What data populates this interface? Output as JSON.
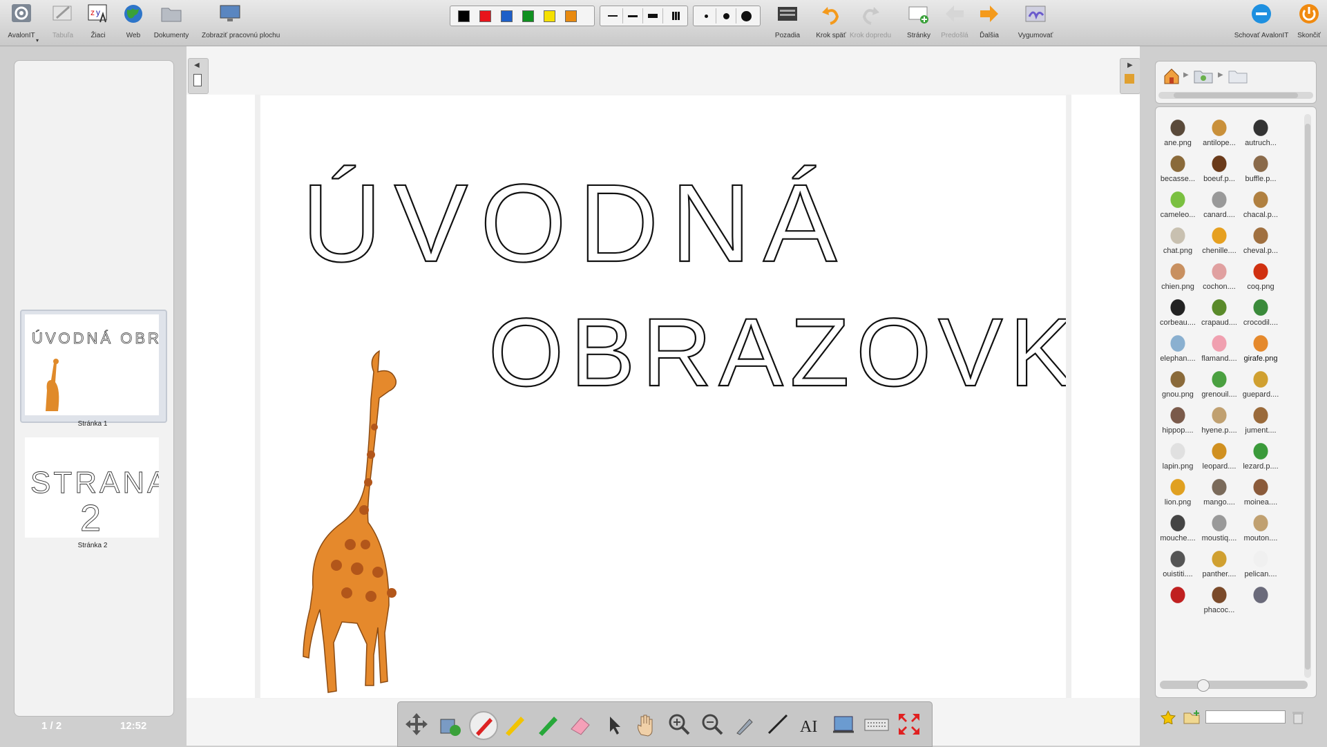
{
  "toolbar": {
    "items": [
      {
        "label": "AvalonIT",
        "icon": "gear-icon"
      },
      {
        "label": "Tabuľa",
        "icon": "board-icon"
      },
      {
        "label": "Žiaci",
        "icon": "students-icon"
      },
      {
        "label": "Web",
        "icon": "globe-icon"
      },
      {
        "label": "Dokumenty",
        "icon": "folder-icon"
      },
      {
        "label": "Zobraziť pracovnú plochu",
        "icon": "monitor-icon"
      },
      {
        "label": "Pozadia",
        "icon": "keyboard-icon"
      },
      {
        "label": "Krok späť",
        "icon": "undo-icon"
      },
      {
        "label": "Krok dopredu",
        "icon": "redo-icon"
      },
      {
        "label": "Stránky",
        "icon": "add-page-icon"
      },
      {
        "label": "Predošlá",
        "icon": "arrow-left-icon"
      },
      {
        "label": "Ďalšia",
        "icon": "arrow-right-icon"
      },
      {
        "label": "Vygumovať",
        "icon": "wipe-icon"
      },
      {
        "label": "Schovať AvalonIT",
        "icon": "minimize-icon"
      },
      {
        "label": "Skončiť",
        "icon": "power-icon"
      }
    ],
    "colors": [
      "#000000",
      "#e8141b",
      "#1e5fc8",
      "#109020",
      "#f5e000",
      "#e88a10"
    ],
    "accent": "#f49a1c"
  },
  "canvas": {
    "handwriting_line1": "ÚVODNÁ",
    "handwriting_line2": "OBRAZOVKA",
    "image_name": "girafe.png"
  },
  "pages": {
    "thumb1_text": "ÚVODNÁ OBRAZOVKA",
    "thumb1_label": "Stránka 1",
    "thumb2_text_line1": "STRANA",
    "thumb2_text_line2": "2",
    "thumb2_label": "Stránka 2",
    "counter": "1 / 2",
    "clock": "12:52"
  },
  "gallery": {
    "items": [
      "ane.png",
      "antilope...",
      "autruch...",
      "becasse...",
      "boeuf.p...",
      "buffle.p...",
      "cameleo...",
      "canard....",
      "chacal.p...",
      "chat.png",
      "chenille....",
      "cheval.p...",
      "chien.png",
      "cochon....",
      "coq.png",
      "corbeau....",
      "crapaud....",
      "crocodil....",
      "elephan....",
      "flamand....",
      "girafe.png",
      "gnou.png",
      "grenouil....",
      "guepard....",
      "hippop....",
      "hyene.p....",
      "jument....",
      "lapin.png",
      "leopard....",
      "lezard.p....",
      "lion.png",
      "mango....",
      "moinea....",
      "mouche....",
      "moustiq....",
      "mouton....",
      "ouistiti....",
      "panther....",
      "pelican....",
      "",
      "phacoc...",
      ""
    ],
    "selected": "girafe.png"
  }
}
